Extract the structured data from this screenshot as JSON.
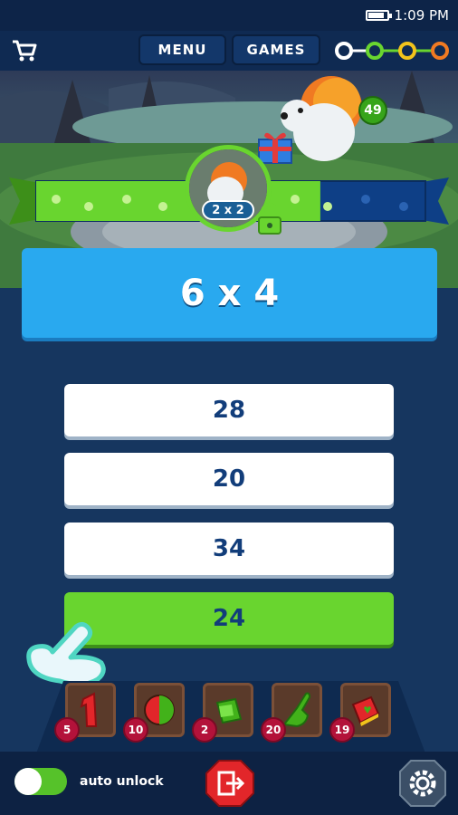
{
  "status_bar": {
    "time": "1:09 PM",
    "battery_level": 0.8
  },
  "top_nav": {
    "cart_icon": "cart-icon",
    "menu_label": "MENU",
    "games_label": "GAMES",
    "chain_icon": "level-chain-icon"
  },
  "scene": {
    "badge_value": "49",
    "unlock_label": "2 x 2",
    "progress_fraction": 0.73,
    "colors": {
      "progress": "#69d52f",
      "track": "#0e3f86"
    }
  },
  "question": {
    "text": "6 x 4"
  },
  "answers": [
    "28",
    "20",
    "34",
    "24"
  ],
  "powerups": [
    {
      "icon": "number-one-icon",
      "count": "5"
    },
    {
      "icon": "half-circle-icon",
      "count": "10"
    },
    {
      "icon": "green-block-icon",
      "count": "2"
    },
    {
      "icon": "pointing-hand-icon",
      "count": "20"
    },
    {
      "icon": "book-icon",
      "count": "19"
    }
  ],
  "bottom_bar": {
    "auto_unlock_label": "auto unlock",
    "exit_icon": "exit-icon",
    "settings_icon": "gear-icon"
  },
  "colors": {
    "background": "#16365f",
    "question_panel": "#29a9ef",
    "correct_answer": "#69d52f",
    "answer_text": "#123d7a",
    "badge_red": "#b3123a"
  }
}
